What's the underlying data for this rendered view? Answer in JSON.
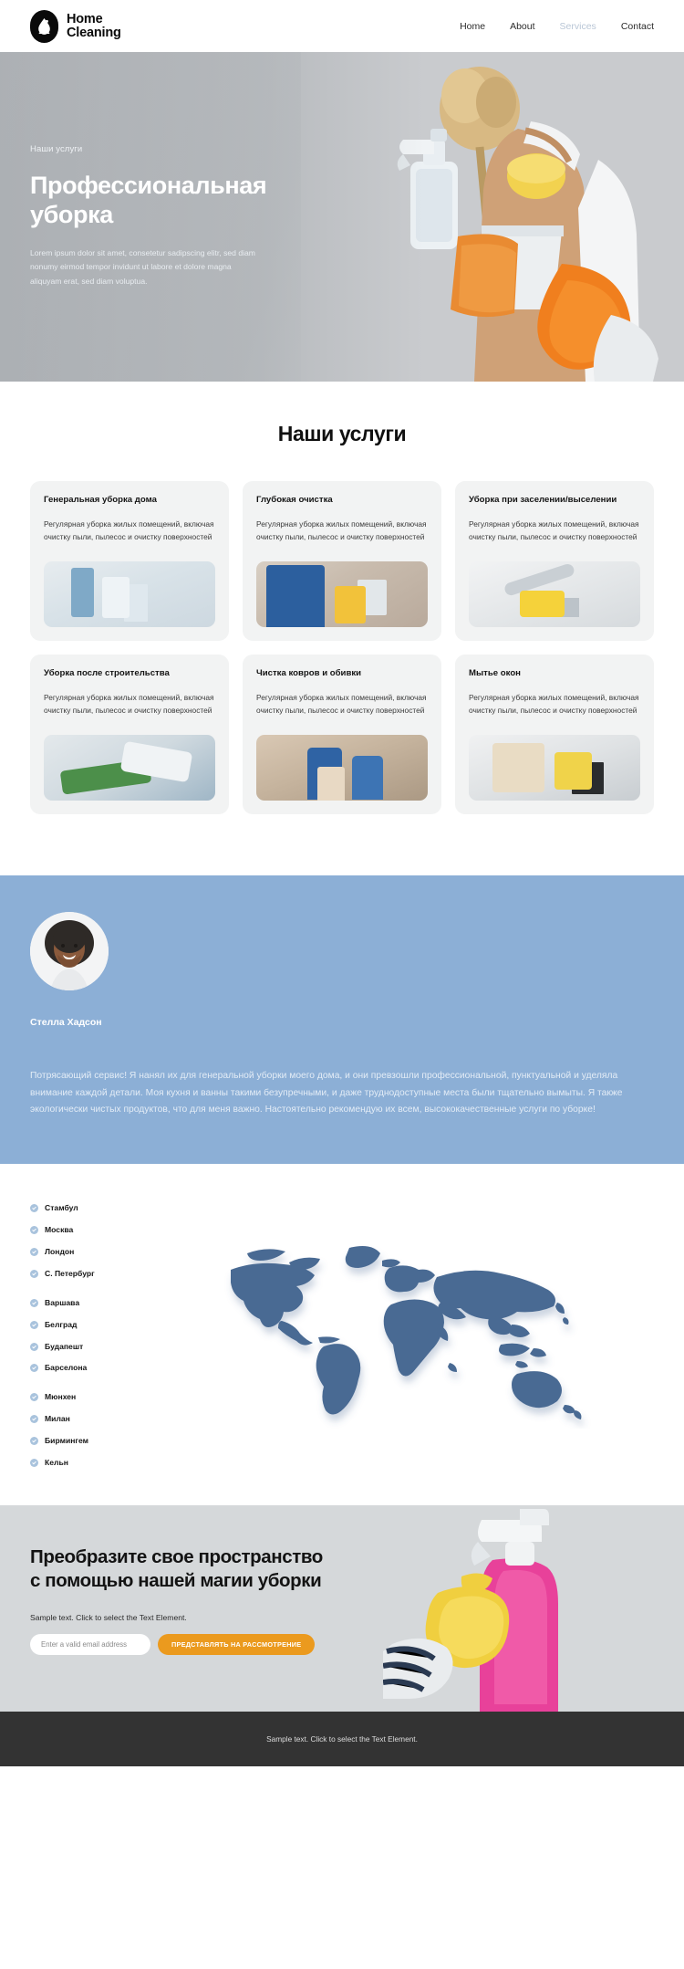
{
  "header": {
    "brand_line1": "Home",
    "brand_line2": "Cleaning",
    "logo_icon": "water-drop-in-circle-icon",
    "nav": [
      {
        "label": "Home",
        "active": false
      },
      {
        "label": "About",
        "active": false
      },
      {
        "label": "Services",
        "active": true
      },
      {
        "label": "Contact",
        "active": false
      }
    ]
  },
  "hero": {
    "eyebrow": "Наши услуги",
    "title": "Профессиональная уборка",
    "text": "Lorem ipsum dolor sit amet, consetetur sadipscing elitr, sed diam nonumy eirmod tempor invidunt ut labore et dolore magna aliquyam erat, sed diam voluptua.",
    "image_alt": "cleaner-holding-supplies-photo"
  },
  "services": {
    "title": "Наши услуги",
    "common_desc": "Регулярная уборка жилых помещений, включая очистку пыли, пылесос и очистку поверхностей",
    "cards": [
      {
        "title": "Генеральная уборка дома",
        "desc": "Регулярная уборка жилых помещений, включая очистку пыли, пылесос и очистку поверхностей",
        "image_alt": "spray-bottles-photo"
      },
      {
        "title": "Глубокая очистка",
        "desc": "Регулярная уборка жилых помещений, включая очистку пыли, пылесос и очистку поверхностей",
        "image_alt": "worker-in-blue-uniform-photo"
      },
      {
        "title": "Уборка при заселении/выселении",
        "desc": "Регулярная уборка жилых помещений, включая очистку пыли, пылесос и очистку поверхностей",
        "image_alt": "cleaning-tools-photo"
      },
      {
        "title": "Уборка после строительства",
        "desc": "Регулярная уборка жилых помещений, включая очистку пыли, пылесос и очистку поверхностей",
        "image_alt": "gloved-hand-with-sponge-photo"
      },
      {
        "title": "Чистка ковров и обивки",
        "desc": "Регулярная уборка жилых помещений, включая очистку пыли, пылесос и очистку поверхностей",
        "image_alt": "two-cleaners-in-room-photo"
      },
      {
        "title": "Мытье окон",
        "desc": "Регулярная уборка жилых помещений, включая очистку пыли, пылесос и очистку поверхностей",
        "image_alt": "window-cleaning-photo"
      }
    ]
  },
  "testimonial": {
    "avatar_alt": "smiling-woman-avatar",
    "name": "Стелла Хадсон",
    "text": "Потрясающий сервис! Я нанял их для генеральной уборки моего дома, и они превзошли профессиональной, пунктуальной и уделяла внимание каждой детали. Моя кухня и ванны такими безупречными, и даже труднодоступные места были тщательно вымыты. Я также  экологически чистых продуктов, что для меня важно. Настоятельно рекомендую их всем, высококачественные услуги по уборке!",
    "bg_color": "#8cafd6"
  },
  "locations": {
    "map_alt": "world-map-graphic",
    "map_color": "#4a6a93",
    "groups": [
      {
        "items": [
          "Стамбул",
          "Москва",
          "Лондон",
          "С. Петербург"
        ]
      },
      {
        "items": [
          "Варшава",
          "Белград",
          "Будапешт",
          "Барселона"
        ]
      },
      {
        "items": [
          "Мюнхен",
          "Милан",
          "Бирмингем",
          "Кельн"
        ]
      }
    ]
  },
  "cta": {
    "title": "Преобразите свое пространство с помощью нашей магии уборки",
    "subtitle": "Sample text. Click to select the Text Element.",
    "email_placeholder": "Enter a valid email address",
    "button_label": "ПРЕДСТАВЛЯТЬ НА РАССМОТРЕНИЕ",
    "button_color": "#eb9a1e",
    "image_alt": "pink-spray-bottle-in-yellow-glove-photo"
  },
  "footer": {
    "text": "Sample text. Click to select the Text Element.",
    "bg_color": "#333333"
  }
}
